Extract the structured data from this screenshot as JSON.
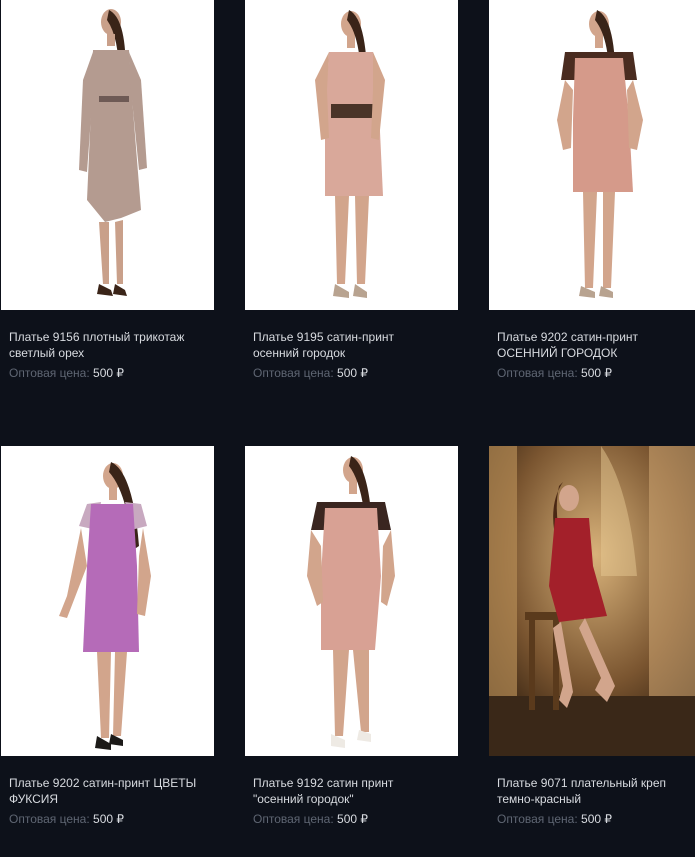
{
  "products": [
    {
      "title_line1": "Платье 9156 плотный трикотаж",
      "title_line2": "светлый орех",
      "price_label": "Оптовая цена:",
      "price": "500 ₽",
      "image_icon": "dress-photo",
      "dress_color": "#b49b90",
      "accent_color": "#6e5a55"
    },
    {
      "title_line1": "Платье 9195 сатин-принт",
      "title_line2": "осенний городок",
      "price_label": "Оптовая цена:",
      "price": "500 ₽",
      "image_icon": "dress-photo",
      "dress_color": "#d9a89a",
      "accent_color": "#4a3428"
    },
    {
      "title_line1": "Платье 9202 сатин-принт",
      "title_line2": "ОСЕННИЙ ГОРОДОК",
      "price_label": "Оптовая цена:",
      "price": "500 ₽",
      "image_icon": "dress-photo",
      "dress_color": "#d59a8a",
      "accent_color": "#4a2c20"
    },
    {
      "title_line1": "Платье 9202 сатин-принт ЦВЕТЫ",
      "title_line2": "ФУКСИЯ",
      "price_label": "Оптовая цена:",
      "price": "500 ₽",
      "image_icon": "dress-photo",
      "dress_color": "#b56bb8",
      "accent_color": "#c8a9c0"
    },
    {
      "title_line1": "Платье 9192 сатин принт",
      "title_line2": "\"осенний городок\"",
      "price_label": "Оптовая цена:",
      "price": "500 ₽",
      "image_icon": "dress-photo",
      "dress_color": "#d8a194",
      "accent_color": "#3a2620"
    },
    {
      "title_line1": "Платье 9071 плательный креп",
      "title_line2": "темно-красный",
      "price_label": "Оптовая цена:",
      "price": "500 ₽",
      "image_icon": "dress-photo-interior",
      "dress_color": "#a3202a",
      "accent_color": "#5a3a1c"
    }
  ]
}
